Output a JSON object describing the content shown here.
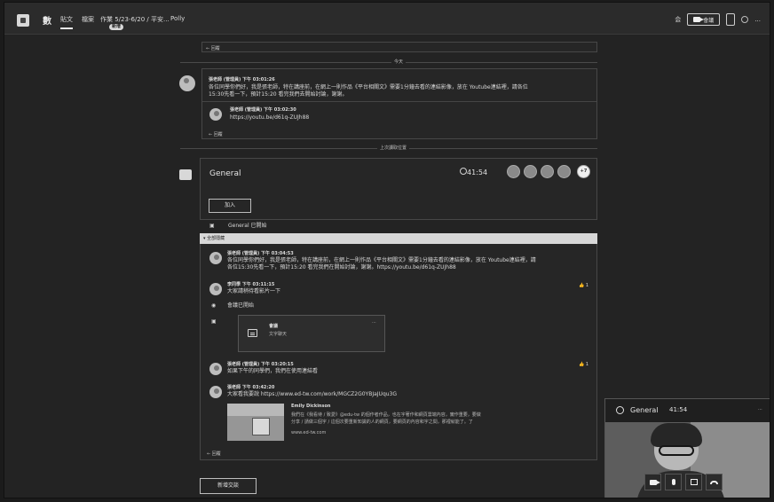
{
  "app": {
    "team_glyph": "數",
    "tabs": [
      "貼文",
      "檔案",
      "作業 5/23-6/20 / 平安...",
      "Polly"
    ],
    "tab_badge": "新增",
    "meet_label": "會議",
    "top_right_marker": "会",
    "window_controls": "..."
  },
  "dividers": {
    "today": "今天",
    "last_read": "上次讀取位置"
  },
  "older_thread": {
    "reply": "← 回覆",
    "message_author_meta": "張老師 (管理員) 下午 03:01:26",
    "message_line_1": "各位同學你們好，我是張老師，特在講座前，在網上一則作品《平台相關文》需要1分鐘去看的連結影像，放在 Youtube連結裡，請各位",
    "message_line_2": "15:30先看一下，預計15:20 看完我們去開始討論，謝謝。",
    "child_author_meta": "張老師 (管理員) 下午 03:02:30",
    "child_link": "https://youtu.be/d61q-ZUJh88",
    "child_reply": "← 回覆"
  },
  "meeting": {
    "title": "General",
    "timer": "41:54",
    "join_label": "加入",
    "status": "General 已開始",
    "participants_more": "+7",
    "section_banner": "▾ 全部隱藏"
  },
  "thread": {
    "post1_meta": "張老師 (管理員) 下午 03:04:53",
    "post1_line1": "各位同學你們好，我是張老師，特在講座前，在網上一則作品《平台相關文》需要1分鐘去看的連結影像，放在 Youtube連結裡，請",
    "post1_line2": "各位15:30先看一下，預計15:20 看完我們在開始討論，謝謝。https://youtu.be/d61q-ZUJh88",
    "post2_meta": "李同學 下午 03:11:15",
    "post2_text": "大家請稍待看影片一下",
    "post2_like": "1",
    "post3_status": "會議已開始",
    "card_title": "會議",
    "card_subtitle": "文字聊天",
    "post4_meta": "張老師 (管理員) 下午 03:20:15",
    "post4_text": "如果下午的同學們，我們在使用連結看",
    "post4_like": "1",
    "post5_meta": "張老師 下午 03:42:20",
    "post5_text": "大家看我要說 https://www.ed-tw.com/work/MGCZ2G0YBJaJUqu3G",
    "preview_title": "Emily Dickinson",
    "preview_line1": "我們在《我看待 / 致愛》@edu-tw 的個作者作品，也在字著作和網頁雲端內容，實作重要，要做",
    "preview_line2": "分享 / 請做三個字 / 這個次要重新知識的人的網頁，要網頁的內容和字之間，那裡就能了。了",
    "preview_link": "www.ed-tw.com",
    "reply": "← 回覆"
  },
  "composer": {
    "new_conversation": "新增交談"
  },
  "popout": {
    "title": "General",
    "timer": "41:54",
    "more": "..."
  },
  "colors": {
    "background": "#232323",
    "panel": "#262626",
    "border": "#474747",
    "text": "#d8d8d8"
  }
}
